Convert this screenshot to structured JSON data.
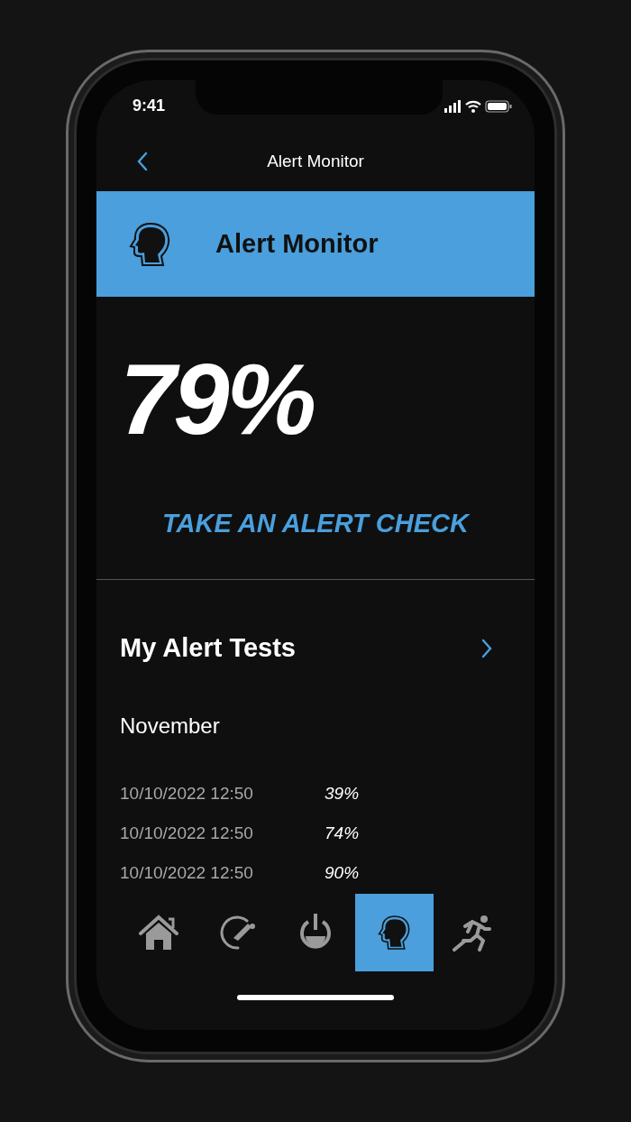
{
  "status_bar": {
    "time": "9:41"
  },
  "nav": {
    "title": "Alert Monitor"
  },
  "banner": {
    "title": "Alert Monitor"
  },
  "score": "79%",
  "action": "TAKE AN ALERT CHECK",
  "tests": {
    "title": "My Alert Tests",
    "month": "November",
    "rows": [
      {
        "date": "10/10/2022 12:50",
        "value": "39%"
      },
      {
        "date": "10/10/2022 12:50",
        "value": "74%"
      },
      {
        "date": "10/10/2022 12:50",
        "value": "90%"
      }
    ]
  },
  "tab_bar": [
    {
      "kind": "home",
      "selected": false
    },
    {
      "kind": "gauge",
      "selected": false
    },
    {
      "kind": "power",
      "selected": false
    },
    {
      "kind": "head",
      "selected": true
    },
    {
      "kind": "runner",
      "selected": false
    }
  ]
}
